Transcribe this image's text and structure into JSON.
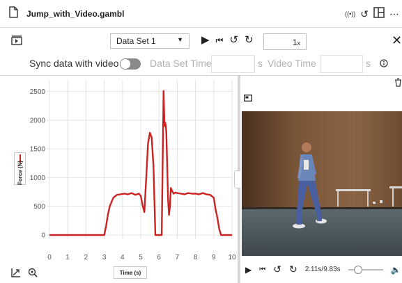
{
  "window": {
    "file_title": "Jump_with_Video.gambl"
  },
  "toolbar": {
    "dataset_selected": "Data Set 1",
    "rate_value": "1",
    "rate_unit": "x"
  },
  "sync": {
    "label": "Sync data with video",
    "enabled": false,
    "dataset_time_label": "Data Set Time",
    "dataset_time_value": "",
    "unit": "s",
    "video_time_label": "Video Time",
    "video_time_value": ""
  },
  "graph": {
    "xlabel_text": "Time (s)",
    "ylabel_text": "Force (N)",
    "x_ticks": [
      "0",
      "1",
      "2",
      "3",
      "4",
      "5",
      "6",
      "7",
      "8",
      "9",
      "10"
    ],
    "y_ticks": [
      "0",
      "500",
      "1000",
      "1500",
      "2000",
      "2500"
    ]
  },
  "chart_data": {
    "type": "line",
    "xlabel": "Time (s)",
    "ylabel": "Force (N)",
    "xlim": [
      0,
      10
    ],
    "ylim": [
      0,
      2700
    ],
    "grid": true,
    "series": [
      {
        "name": "Force (N)",
        "color": "#cc2222",
        "x": [
          0,
          3.0,
          3.1,
          3.2,
          3.3,
          3.5,
          3.7,
          3.9,
          4.1,
          4.3,
          4.5,
          4.7,
          4.9,
          5.0,
          5.1,
          5.2,
          5.3,
          5.4,
          5.5,
          5.6,
          5.7,
          5.8,
          5.85,
          5.9,
          5.95,
          6.0,
          6.05,
          6.1,
          6.15,
          6.2,
          6.25,
          6.3,
          6.35,
          6.4,
          6.45,
          6.5,
          6.55,
          6.6,
          6.65,
          6.7,
          6.8,
          6.9,
          7.0,
          7.2,
          7.4,
          7.6,
          7.8,
          8.0,
          8.2,
          8.4,
          8.6,
          8.8,
          9.0,
          9.1,
          9.2,
          9.3,
          9.4,
          10.0
        ],
        "y": [
          0,
          0,
          150,
          350,
          500,
          650,
          700,
          710,
          720,
          710,
          730,
          700,
          720,
          680,
          520,
          400,
          1000,
          1600,
          1780,
          1700,
          1200,
          0,
          0,
          0,
          0,
          0,
          0,
          0,
          0,
          1200,
          2510,
          1900,
          1950,
          1800,
          1200,
          600,
          350,
          500,
          820,
          780,
          720,
          740,
          730,
          720,
          710,
          730,
          720,
          720,
          710,
          730,
          710,
          700,
          650,
          450,
          300,
          100,
          0,
          0
        ]
      }
    ]
  },
  "video": {
    "time_display": "2.11s/9.83s",
    "position_fraction": 0.215
  },
  "icons": {
    "file": "file-icon",
    "radio": "broadcast-icon",
    "revert": "revert-icon",
    "layout": "layout-icon",
    "more": "more-icon"
  }
}
